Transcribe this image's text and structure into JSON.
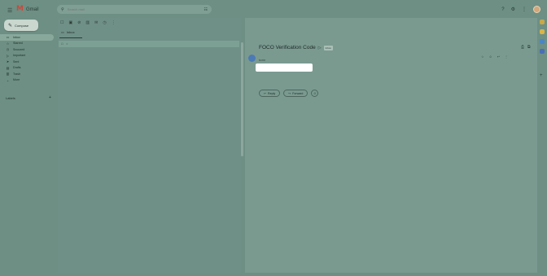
{
  "header": {
    "menu_icon": "hamburger-icon",
    "app_name": "Gmail",
    "search": {
      "placeholder": "Search mail"
    },
    "right_icons": [
      "help-icon",
      "settings-icon",
      "apps-icon"
    ]
  },
  "sidebar": {
    "compose_label": "Compose",
    "items": [
      {
        "label": "Inbox",
        "icon": "inbox-icon",
        "count": "",
        "active": true
      },
      {
        "label": "Starred",
        "icon": "star-icon",
        "count": ""
      },
      {
        "label": "Snoozed",
        "icon": "clock-icon",
        "count": ""
      },
      {
        "label": "Important",
        "icon": "important-icon",
        "count": ""
      },
      {
        "label": "Sent",
        "icon": "send-icon",
        "count": ""
      },
      {
        "label": "Drafts",
        "icon": "draft-icon",
        "count": ""
      },
      {
        "label": "Trash",
        "icon": "trash-icon",
        "count": ""
      },
      {
        "label": "More",
        "icon": "chevron-down-icon",
        "count": ""
      }
    ],
    "labels_heading": "Labels",
    "labels_add": "+"
  },
  "list": {
    "tab_label": "Inbox",
    "row": {
      "sender": "",
      "subject": "",
      "date": ""
    }
  },
  "reader": {
    "subject": "FOCO Verification Code",
    "badge": "Inbox",
    "to_me": "to me",
    "date": "",
    "otp_line": "",
    "body": "",
    "reply_label": "Reply",
    "forward_label": "Forward"
  },
  "colors": {
    "overlay": "#6d8f84",
    "reader_bg": "#7a9a90",
    "otp_box": "#ffffff",
    "sender_avatar": "#4b7ab5"
  }
}
